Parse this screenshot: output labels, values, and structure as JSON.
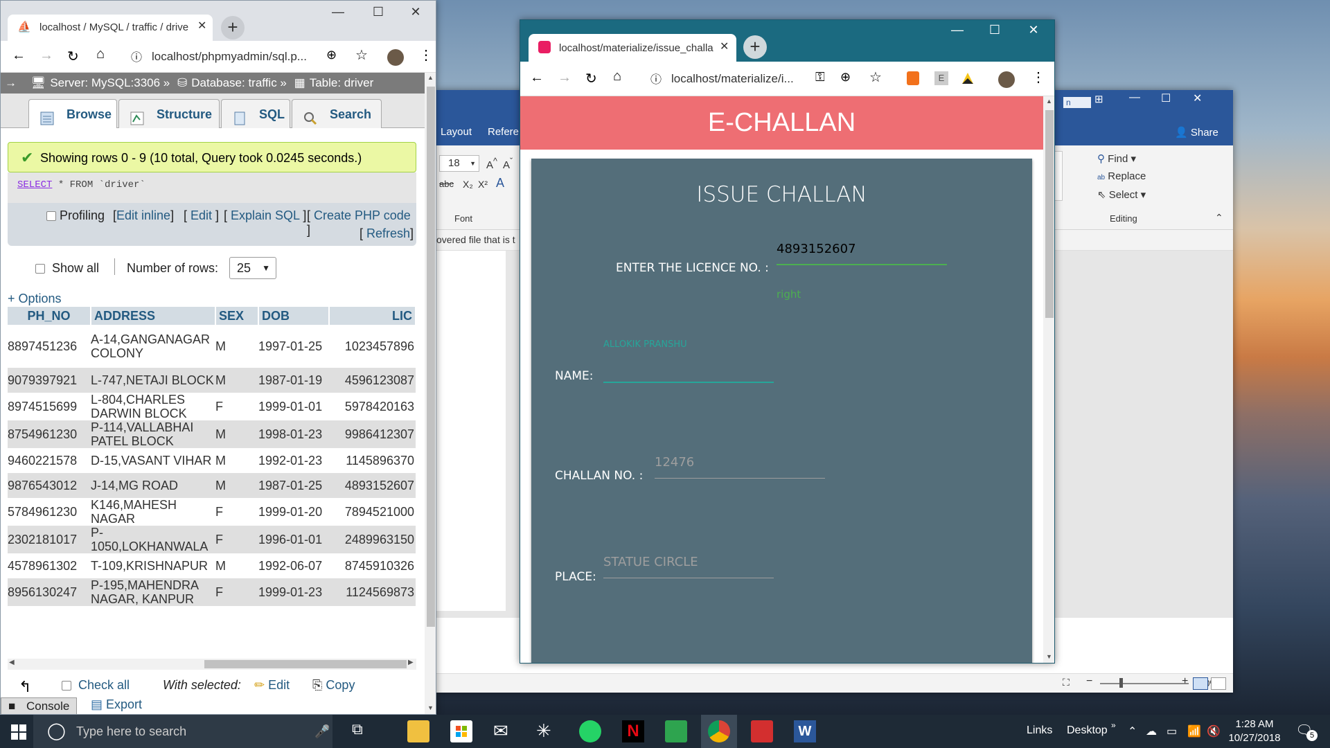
{
  "pma": {
    "tab_title": "localhost / MySQL / traffic / drive",
    "url": "localhost/phpmyadmin/sql.p...",
    "breadcrumb": {
      "server": "Server: MySQL:3306 »",
      "database": "Database: traffic »",
      "table": "Table: driver"
    },
    "tabs": [
      "Browse",
      "Structure",
      "SQL",
      "Search"
    ],
    "success_msg": "Showing rows 0 - 9 (10 total, Query took 0.0245 seconds.)",
    "sql": {
      "keyword": "SELECT",
      "rest": " * FROM `driver`"
    },
    "profiling": {
      "label": "Profiling",
      "edit_inline": "Edit inline",
      "edit": "Edit",
      "explain": "Explain SQL",
      "create_php": "Create PHP code",
      "refresh": "Refresh"
    },
    "show_all": "Show all",
    "num_rows_label": "Number of rows:",
    "num_rows_value": "25",
    "options": "+ Options",
    "columns": [
      "PH_NO",
      "ADDRESS",
      "SEX",
      "DOB",
      "LIC"
    ],
    "rows": [
      [
        "8897451236",
        "A-14,GANGANAGAR COLONY",
        "M",
        "1997-01-25",
        "1023457896"
      ],
      [
        "9079397921",
        "L-747,NETAJI BLOCK",
        "M",
        "1987-01-19",
        "4596123087"
      ],
      [
        "8974515699",
        "L-804,CHARLES DARWIN BLOCK",
        "F",
        "1999-01-01",
        "5978420163"
      ],
      [
        "8754961230",
        "P-114,VALLABHAI PATEL BLOCK",
        "M",
        "1998-01-23",
        "9986412307"
      ],
      [
        "9460221578",
        "D-15,VASANT VIHAR",
        "M",
        "1992-01-23",
        "1145896370"
      ],
      [
        "9876543012",
        "J-14,MG ROAD",
        "M",
        "1987-01-25",
        "4893152607"
      ],
      [
        "5784961230",
        "K146,MAHESH NAGAR",
        "F",
        "1999-01-20",
        "7894521000"
      ],
      [
        "2302181017",
        "P-1050,LOKHANWALA",
        "F",
        "1996-01-01",
        "2489963150"
      ],
      [
        "4578961302",
        "T-109,KRISHNAPUR",
        "M",
        "1992-06-07",
        "8745910326"
      ],
      [
        "8956130247",
        "P-195,MAHENDRA NAGAR, KANPUR",
        "F",
        "1999-01-23",
        "1124569873"
      ]
    ],
    "check_all": "Check all",
    "with_selected": "With selected:",
    "edit": "Edit",
    "copy": "Copy",
    "export": "Export",
    "console": "Console"
  },
  "word": {
    "tabs": [
      "Layout",
      "Referen"
    ],
    "share": "Share",
    "font_size": "18",
    "font_group": "Font",
    "editing_group": "Editing",
    "find": "Find",
    "replace": "Replace",
    "select": "Select",
    "doc_text": "overed file that is t",
    "zoom": "60%",
    "tab_letter": "n"
  },
  "echallan": {
    "tab_title": "localhost/materialize/issue_challa",
    "url": "localhost/materialize/i...",
    "header": "E-CHALLAN",
    "card_title": "ISSUE CHALLAN",
    "licence_label": "ENTER THE LICENCE NO. :",
    "licence_value": "4893152607",
    "licence_status": "right",
    "name_hint": "ALLOKIK PRANSHU",
    "name_label": "NAME:",
    "challan_label": "CHALLAN NO. :",
    "challan_placeholder": "12476",
    "place_label": "PLACE:",
    "place_placeholder": "STATUE CIRCLE",
    "accent_color": "#ee6e73",
    "card_color": "#546e7a"
  },
  "taskbar": {
    "search_placeholder": "Type here to search",
    "links": "Links",
    "desktop": "Desktop",
    "time": "1:28 AM",
    "date": "10/27/2018",
    "notif_count": "5"
  }
}
